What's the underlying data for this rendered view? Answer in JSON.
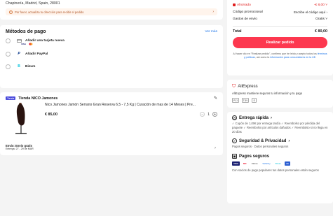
{
  "address": {
    "line": "Chapinería, Madrid, Spain, 28001",
    "warning": "Por favor, actualiza tu dirección para recibir el pedido"
  },
  "payment": {
    "title": "Métodos de pago",
    "see_more": "Ver más",
    "options": [
      {
        "label": "Añadir una tarjeta nueva",
        "icon": "credit-card-icon"
      },
      {
        "label": "Añadir PayPal",
        "icon": "paypal-icon"
      },
      {
        "label": "Bizum",
        "icon": "bizum-icon"
      }
    ],
    "card_brands": [
      "VISA",
      "MC"
    ]
  },
  "store": {
    "badge": "Tienda",
    "name": "Tienda NICO Jamones",
    "product_title": "Nico Jamones Jamón Serrano Gran Reserva 6,5 - 7,5 Kg | Curación de mas de 14 Meses | Pre...",
    "price": "€ 85,00",
    "quantity": "1",
    "shipping_line1": "Envío: Envío gratis",
    "shipping_line2": "Entrega: 27 - 29 de MAR"
  },
  "summary": {
    "saved_label": "Ahorrado",
    "saved_value": "-€ 8,00",
    "promo_label": "Código promocional",
    "promo_value": "Escribe el código aquí",
    "shipping_label": "Gastos de envío",
    "shipping_value": "Gratis",
    "total_label": "Total",
    "total_value": "€ 80,00",
    "order_button": "Realizar pedido",
    "legal_pre": "Al hacer clic en \"Realizar pedido\", confirmo que he leído y acepto todos los ",
    "legal_link1": "términos y políticas",
    "legal_mid": ", así como la ",
    "legal_link2": "información para consumidores en la UE",
    "legal_end": "."
  },
  "aliexpress": {
    "brand": "AliExpress",
    "text": "AliExpress mantiene seguros tu información y tu pago",
    "badges": [
      "PCI",
      "TÜV",
      "S"
    ]
  },
  "trust": {
    "fast_title": "Entrega rápida",
    "fast_body": "✓ Cupón de 1,00€ por entrega tardía ✓ Reembolso por pérdida del paquete ✓ Reembolso por artículos dañados ✓ Reembolso si no llega en 20 días",
    "secure_title": "Seguridad & Privacidad",
    "secure_body": "Pagos seguros · Datos personales seguros",
    "pay_title": "Pagos seguros",
    "pay_logos": [
      "VISA",
      "MC",
      "Klarna",
      "SafePay",
      "Bizum",
      "AE"
    ],
    "pay_body": "Con socios de pago populares tus datos personales están seguros"
  },
  "colors": {
    "accent": "#fd384f",
    "link": "#1a73e8",
    "saved": "#e02020",
    "store_badge": "#4b4bdc"
  }
}
